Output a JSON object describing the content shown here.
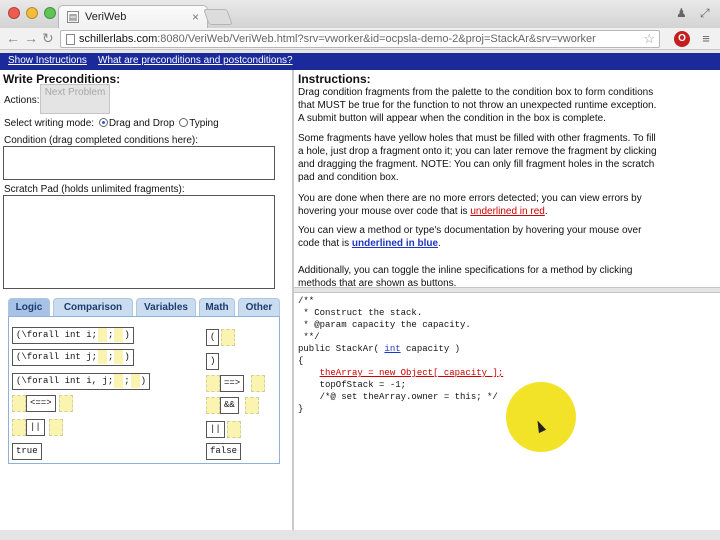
{
  "browser": {
    "tab_title": "VeriWeb",
    "tab_favicon": "page-icon",
    "url_host": "schillerlabs.com",
    "url_rest": ":8080/VeriWeb/VeriWeb.html?srv=vworker&id=ocpsla-demo-2&proj=StackAr&srv=vworker",
    "back_icon": "←",
    "forward_icon": "→",
    "reload_icon": "↻",
    "star_icon": "☆",
    "menu_icon": "≡",
    "lastpass_icon": "O"
  },
  "appbar": {
    "link1": "Show Instructions",
    "link2": "What are preconditions and postconditions?"
  },
  "left": {
    "title": "Write Preconditions:",
    "actions_label": "Actions:",
    "next_button": "Next Problem",
    "mode_label": "Select writing mode:",
    "mode_dnd": "Drag and Drop",
    "mode_typing": "Typing",
    "condition_label": "Condition (drag completed conditions here):",
    "scratch_label": "Scratch Pad (holds unlimited fragments):",
    "tabs": [
      "Logic",
      "Comparison",
      "Variables",
      "Math",
      "Other"
    ],
    "fragments": {
      "f1": "(\\forall int i;",
      "f2": "(\\forall int j;",
      "f3": "(\\forall int i, j;",
      "semi": ";",
      "close": ")",
      "iff": "<==>",
      "impl": "==>",
      "and": "&&",
      "or": "||",
      "true": "true",
      "false": "false",
      "open": "(",
      "close2": ")"
    }
  },
  "right": {
    "title": "Instructions:",
    "p1": "Drag condition fragments from the palette to the condition box to form conditions that MUST be true for the function to not throw an unexpected runtime exception. A submit button will appear when the condition in the box is complete.",
    "p2": "Some fragments have yellow holes that must be filled with other fragments. To fill a hole, just drop a fragment onto it; you can later remove the fragment by clicking and dragging the fragment. NOTE: You can only fill fragment holes in the scratch pad and condition box.",
    "p3a": "You are done when there are no more errors detected; you can view errors by hovering your mouse over code that is ",
    "p3red": "underlined in red",
    "p3b": ".",
    "p4a": "You can view a method or type's documentation by hovering your mouse over code that is ",
    "p4blue": "underlined in blue",
    "p4b": ".",
    "p5": "Additionally, you can toggle the inline specifications for a method by clicking methods that are shown as buttons.",
    "code": {
      "l1": "/**",
      "l2": " * Construct the stack.",
      "l3": " * @param capacity the capacity.",
      "l4": " **/",
      "l5a": "public StackAr( ",
      "l5b": "int",
      "l5c": " capacity )",
      "l6": "{",
      "l7a": "    ",
      "l7err": "theArray = new Object[ capacity ];",
      "l8": "    topOfStack = -1;",
      "l9": "    /*@ set theArray.owner = this; */",
      "l10": "}"
    }
  }
}
